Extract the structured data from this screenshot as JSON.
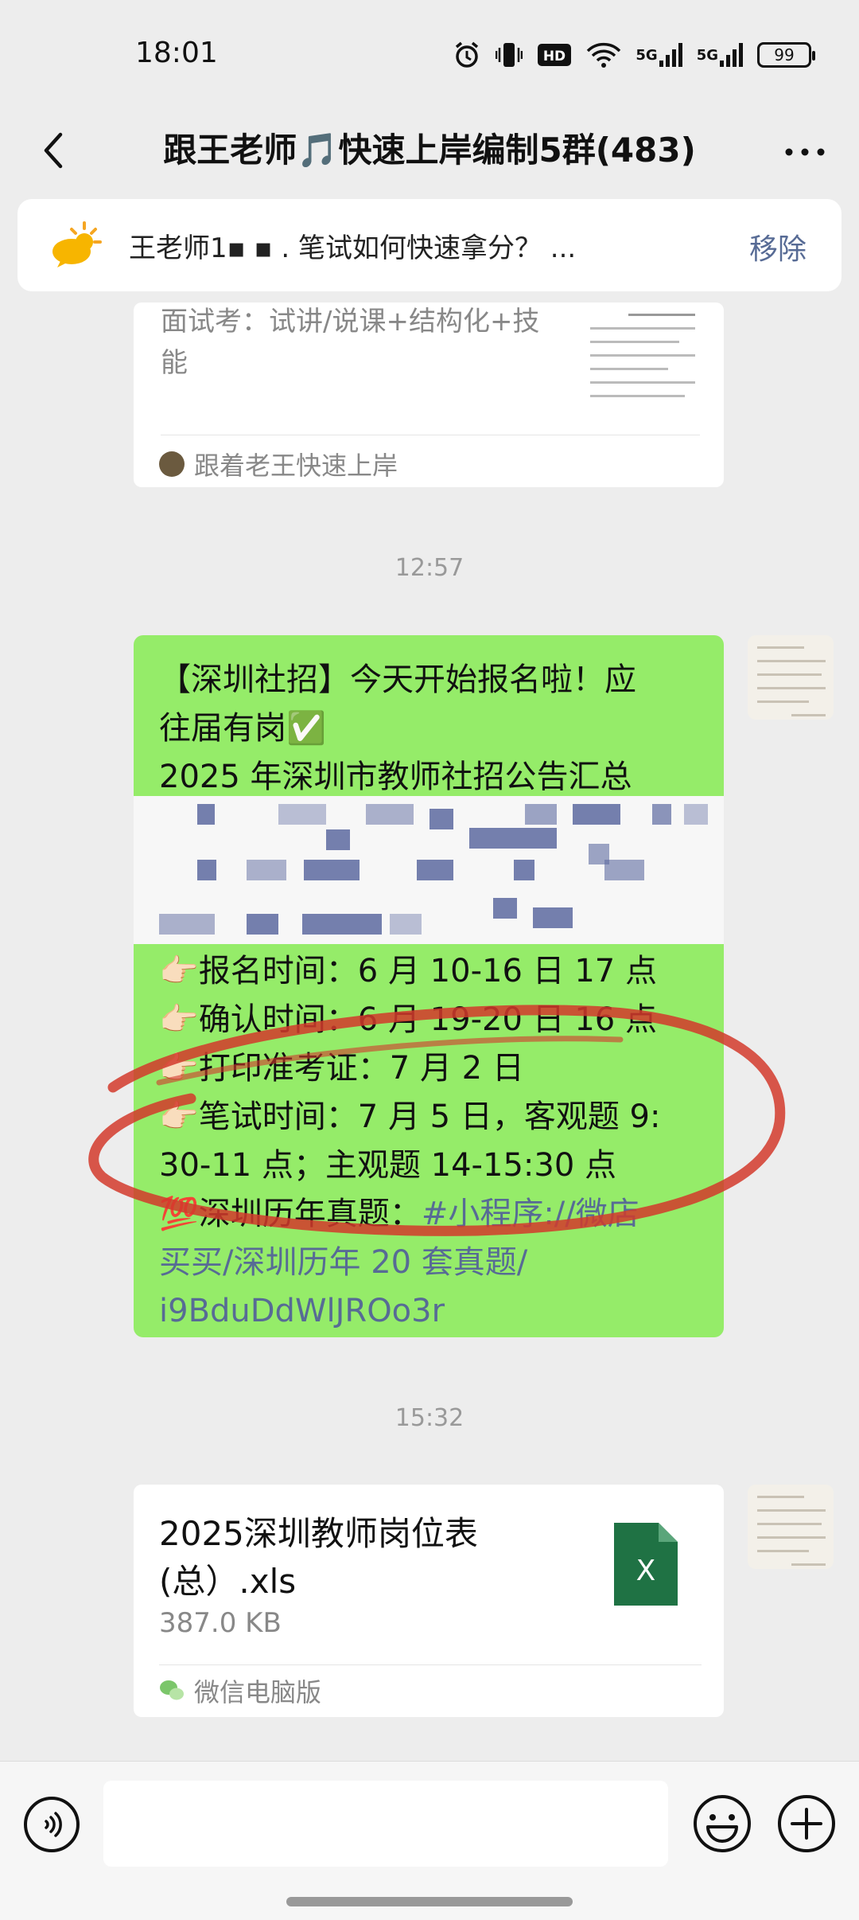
{
  "status_bar": {
    "time": "18:01",
    "hd_label": "HD",
    "sim1_label": "5G",
    "sim2_label": "5G",
    "battery": "99",
    "icons": [
      "alarm-icon",
      "vibrate-icon",
      "hd-icon",
      "wifi-icon",
      "signal-5g-icon",
      "signal-5g-icon",
      "battery-icon"
    ]
  },
  "nav": {
    "title": "跟王老师🎵快速上岸编制5群(483)",
    "back_icon": "chevron-left-icon",
    "more_icon": "more-dots-icon"
  },
  "pinned": {
    "text": "王老师1▪          ▪          . 笔试如何快速拿分？ ...",
    "remove_label": "移除",
    "icon": "sun-cloud-icon"
  },
  "messages": {
    "share_card": {
      "desc": "面试考：试讲/说课+结构化+技能",
      "source": "跟着老王快速上岸"
    },
    "time_1": "12:57",
    "text_message": {
      "line1": "【深圳社招】今天开始报名啦！应",
      "line2": "往届有岗✅",
      "line3": "2025 年深圳市教师社招公告汇总",
      "line4": "👉🏻报名时间：6 月 10-16 日 17 点",
      "line5": "👉🏻确认时间：6 月 19-20 日 16 点",
      "line6": "👉🏻打印准考证：7 月 2 日",
      "line7": "👉🏻笔试时间：7 月 5 日，客观题 9:",
      "line8": "30-11 点；主观题 14-15:30 点",
      "line9_prefix": "💯深圳历年真题：",
      "line9_link": "#小程序://微店",
      "line10_link": "买买/深圳历年 20 套真题/",
      "line11_link": "i9BduDdWlJROo3r"
    },
    "time_2": "15:32",
    "file_message": {
      "name_line1": "2025深圳教师岗位表",
      "name_line2": "(总）.xls",
      "size": "387.0 KB",
      "file_icon_letter": "X",
      "source": "微信电脑版"
    }
  },
  "input_bar": {
    "voice_icon": "voice-icon",
    "emoji_icon": "emoji-icon",
    "plus_icon": "plus-icon",
    "placeholder": ""
  },
  "colors": {
    "background": "#ededed",
    "bubble_green": "#95ec69",
    "link_blue": "#576b95",
    "excel_green": "#1f7244",
    "annotation_red": "#d2392b"
  }
}
